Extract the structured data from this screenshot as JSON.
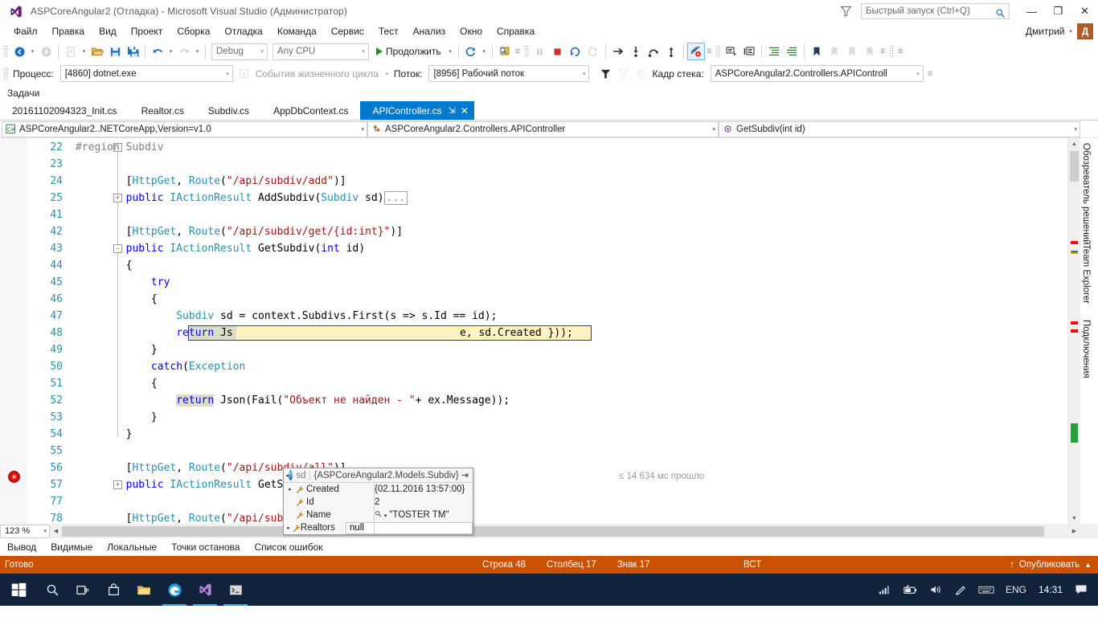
{
  "window": {
    "title": "ASPCoreAngular2 (Отладка) - Microsoft Visual Studio (Администратор)",
    "quick_launch_placeholder": "Быстрый запуск (Ctrl+Q)",
    "minimize": "—",
    "maximize": "❐",
    "close": "✕"
  },
  "menu": {
    "items": [
      "Файл",
      "Правка",
      "Вид",
      "Проект",
      "Сборка",
      "Отладка",
      "Команда",
      "Сервис",
      "Тест",
      "Анализ",
      "Окно",
      "Справка"
    ],
    "user_name": "Дмитрий",
    "user_initial": "Д"
  },
  "toolbar": {
    "config": "Debug",
    "platform": "Any CPU",
    "continue_label": "Продолжить",
    "back_icon": "nav-back-icon",
    "forward_icon": "nav-forward-icon",
    "new_icon": "new-project-icon",
    "open_icon": "open-file-icon",
    "save_icon": "save-icon",
    "save_all_icon": "save-all-icon",
    "undo_icon": "undo-icon",
    "redo_icon": "redo-icon",
    "refresh_icon": "refresh-icon",
    "find_icon": "find-icon",
    "pause_icon": "pause-icon",
    "stop_icon": "stop-icon",
    "restart_icon": "restart-icon",
    "hotreload_icon": "hot-reload-icon",
    "showstmt_icon": "show-next-statement-icon",
    "stepinto_icon": "step-into-icon",
    "stepover_icon": "step-over-icon",
    "stepout_icon": "step-out-icon",
    "breakpoints_icon": "breakpoints-toggle-icon",
    "comment_icon": "comment-icon",
    "uncomment_icon": "uncomment-icon",
    "indent_icon": "indent-icon",
    "outdent_icon": "outdent-icon",
    "bookmark_icon": "bookmark-icon",
    "bm_prev_icon": "bookmark-prev-icon",
    "bm_next_icon": "bookmark-next-icon",
    "bm_clear_icon": "bookmark-clear-icon"
  },
  "debug_toolbar": {
    "process_label": "Процесс:",
    "process_value": "[4860] dotnet.exe",
    "lifecycle_label": "События жизненного цикла",
    "thread_label": "Поток:",
    "thread_value": "[8956] Рабочий поток",
    "stackframe_label": "Кадр стека:",
    "stackframe_value": "ASPCoreAngular2.Controllers.APIControll",
    "filter_icon": "filter-icon",
    "filter2_icon": "filter-threads-icon",
    "noflag_icon": "no-flag-icon"
  },
  "tasks_strip": {
    "label": "Задачи"
  },
  "tabs": {
    "items": [
      {
        "label": "20161102094323_Init.cs",
        "active": false
      },
      {
        "label": "Realtor.cs",
        "active": false
      },
      {
        "label": "Subdiv.cs",
        "active": false
      },
      {
        "label": "AppDbContext.cs",
        "active": false
      },
      {
        "label": "APIController.cs",
        "active": true
      }
    ],
    "pin_glyph": "⇲",
    "close_glyph": "✕"
  },
  "navbar": {
    "project": "ASPCoreAngular2..NETCoreApp,Version=v1.0",
    "project_icon": "csharp-project-icon",
    "class": "ASPCoreAngular2.Controllers.APIController",
    "class_icon": "class-icon",
    "member": "GetSubdiv(int id)",
    "member_icon": "method-icon",
    "arrow": "▾"
  },
  "code": {
    "lines": [
      {
        "num": "22",
        "indent": 0,
        "glyph": "-",
        "segments": [
          {
            "t": "#region Subdiv",
            "c": "pre"
          }
        ]
      },
      {
        "num": "23",
        "indent": 0,
        "glyph": "",
        "segments": []
      },
      {
        "num": "24",
        "indent": 0,
        "glyph": "",
        "segments": [
          {
            "t": "        [",
            "c": "plain"
          },
          {
            "t": "HttpGet",
            "c": "type"
          },
          {
            "t": ", ",
            "c": "plain"
          },
          {
            "t": "Route",
            "c": "type"
          },
          {
            "t": "(",
            "c": "plain"
          },
          {
            "t": "\"/api/subdiv/add\"",
            "c": "str"
          },
          {
            "t": ")]",
            "c": "plain"
          }
        ]
      },
      {
        "num": "25",
        "indent": 0,
        "glyph": "+",
        "segments": [
          {
            "t": "        ",
            "c": "plain"
          },
          {
            "t": "public",
            "c": "kw"
          },
          {
            "t": " ",
            "c": "plain"
          },
          {
            "t": "IActionResult",
            "c": "type"
          },
          {
            "t": " AddSubdiv(",
            "c": "plain"
          },
          {
            "t": "Subdiv",
            "c": "type"
          },
          {
            "t": " sd)",
            "c": "plain"
          },
          {
            "t": "...",
            "c": "collapsed"
          }
        ]
      },
      {
        "num": "41",
        "indent": 0,
        "glyph": "",
        "segments": []
      },
      {
        "num": "42",
        "indent": 0,
        "glyph": "",
        "segments": [
          {
            "t": "        [",
            "c": "plain"
          },
          {
            "t": "HttpGet",
            "c": "type"
          },
          {
            "t": ", ",
            "c": "plain"
          },
          {
            "t": "Route",
            "c": "type"
          },
          {
            "t": "(",
            "c": "plain"
          },
          {
            "t": "\"/api/subdiv/get/{id:int}\"",
            "c": "str"
          },
          {
            "t": ")]",
            "c": "plain"
          }
        ]
      },
      {
        "num": "43",
        "indent": 0,
        "glyph": "-",
        "segments": [
          {
            "t": "        ",
            "c": "plain"
          },
          {
            "t": "public",
            "c": "kw"
          },
          {
            "t": " ",
            "c": "plain"
          },
          {
            "t": "IActionResult",
            "c": "type"
          },
          {
            "t": " GetSubdiv(",
            "c": "plain"
          },
          {
            "t": "int",
            "c": "kw"
          },
          {
            "t": " id)",
            "c": "plain"
          }
        ]
      },
      {
        "num": "44",
        "indent": 0,
        "glyph": "",
        "segments": [
          {
            "t": "        {",
            "c": "plain"
          }
        ]
      },
      {
        "num": "45",
        "indent": 0,
        "glyph": "",
        "segments": [
          {
            "t": "            ",
            "c": "plain"
          },
          {
            "t": "try",
            "c": "kw"
          }
        ]
      },
      {
        "num": "46",
        "indent": 0,
        "glyph": "",
        "segments": [
          {
            "t": "            {",
            "c": "plain"
          }
        ]
      },
      {
        "num": "47",
        "indent": 0,
        "glyph": "",
        "segments": [
          {
            "t": "                ",
            "c": "plain"
          },
          {
            "t": "Subdiv",
            "c": "type"
          },
          {
            "t": " sd = context.Subdivs.First(s => s.Id == id);",
            "c": "plain"
          }
        ]
      },
      {
        "num": "48",
        "indent": 0,
        "glyph": "",
        "current": true,
        "segments": [
          {
            "t": "                ",
            "c": "plain"
          },
          {
            "t": "return",
            "c": "kw"
          },
          {
            "t": " Js",
            "c": "plain"
          }
        ]
      },
      {
        "num": "49",
        "indent": 0,
        "glyph": "",
        "segments": [
          {
            "t": "            }",
            "c": "plain"
          }
        ]
      },
      {
        "num": "50",
        "indent": 0,
        "glyph": "",
        "segments": [
          {
            "t": "            ",
            "c": "plain"
          },
          {
            "t": "catch",
            "c": "kw"
          },
          {
            "t": "(",
            "c": "plain"
          },
          {
            "t": "Exception",
            "c": "type"
          }
        ]
      },
      {
        "num": "51",
        "indent": 0,
        "glyph": "",
        "segments": [
          {
            "t": "            {",
            "c": "plain"
          }
        ]
      },
      {
        "num": "52",
        "indent": 0,
        "glyph": "",
        "segments": [
          {
            "t": "                ",
            "c": "plain"
          },
          {
            "t": "return",
            "c": "kw",
            "hl": true
          },
          {
            "t": " Json(Fail(",
            "c": "plain"
          },
          {
            "t": "\"Объект не найден - \"",
            "c": "str"
          },
          {
            "t": "+ ex.Message));",
            "c": "plain"
          }
        ]
      },
      {
        "num": "53",
        "indent": 0,
        "glyph": "",
        "segments": [
          {
            "t": "            }",
            "c": "plain"
          }
        ]
      },
      {
        "num": "54",
        "indent": 0,
        "glyph": "",
        "segments": [
          {
            "t": "        }",
            "c": "plain"
          }
        ]
      },
      {
        "num": "55",
        "indent": 0,
        "glyph": "",
        "segments": []
      },
      {
        "num": "56",
        "indent": 0,
        "glyph": "",
        "segments": [
          {
            "t": "        [",
            "c": "plain"
          },
          {
            "t": "HttpGet",
            "c": "type"
          },
          {
            "t": ", ",
            "c": "plain"
          },
          {
            "t": "Route",
            "c": "type"
          },
          {
            "t": "(",
            "c": "plain"
          },
          {
            "t": "\"/api/subdiv/all\"",
            "c": "str"
          },
          {
            "t": ")]",
            "c": "plain"
          }
        ]
      },
      {
        "num": "57",
        "indent": 0,
        "glyph": "+",
        "segments": [
          {
            "t": "        ",
            "c": "plain"
          },
          {
            "t": "public",
            "c": "kw"
          },
          {
            "t": " ",
            "c": "plain"
          },
          {
            "t": "IActionResult",
            "c": "type"
          },
          {
            "t": " GetSubdivs()",
            "c": "plain"
          },
          {
            "t": "...",
            "c": "collapsed"
          }
        ]
      },
      {
        "num": "77",
        "indent": 0,
        "glyph": "",
        "segments": []
      },
      {
        "num": "78",
        "indent": 0,
        "glyph": "",
        "segments": [
          {
            "t": "        [",
            "c": "plain"
          },
          {
            "t": "HttpGet",
            "c": "type"
          },
          {
            "t": ", ",
            "c": "plain"
          },
          {
            "t": "Route",
            "c": "type"
          },
          {
            "t": "(",
            "c": "plain"
          },
          {
            "t": "\"/api/subdiv/delete/{id:int}\"",
            "c": "str"
          },
          {
            "t": ")]",
            "c": "plain"
          }
        ]
      }
    ],
    "current_line_tail": "e, sd.Created }));",
    "breakpoint_line": "48"
  },
  "datatip": {
    "expression": "sd",
    "type_value": "{ASPCoreAngular2.Models.Subdiv}",
    "caret": "◂",
    "pin_glyph": "⇥",
    "rows": [
      {
        "expandable": true,
        "name": "Created",
        "value": "{02.11.2016 13:57:00}",
        "edit": false,
        "magnifier": false
      },
      {
        "expandable": false,
        "name": "Id",
        "value": "2",
        "edit": false,
        "magnifier": false
      },
      {
        "expandable": false,
        "name": "Name",
        "value": "\"TOSTER TM\"",
        "edit": false,
        "magnifier": true
      },
      {
        "expandable": true,
        "name": "Realtors",
        "value": "null",
        "edit": true,
        "magnifier": false
      }
    ]
  },
  "perf_tip": {
    "text": "≤ 14 634 мс прошло"
  },
  "right_docks": {
    "items": [
      "Обозреватель решений",
      "Team Explorer",
      "Подключения"
    ]
  },
  "editor_footer": {
    "zoom": "123 %",
    "zoom_arrow": "▾"
  },
  "bottom_tabs": {
    "items": [
      "Вывод",
      "Видимые",
      "Локальные",
      "Точки останова",
      "Список ошибок"
    ]
  },
  "statusbar": {
    "state": "Готово",
    "line_label": "Строка 48",
    "col_label": "Столбец 17",
    "char_label": "Знак 17",
    "insert_mode": "ВСТ",
    "publish": "Опубликовать",
    "publish_arrow": "▲",
    "publish_up": "↑",
    "color": "#ca5100"
  },
  "taskbar": {
    "start_icon": "windows-start-icon",
    "items": [
      {
        "icon": "search-icon",
        "active": false
      },
      {
        "icon": "task-view-icon",
        "active": false
      },
      {
        "icon": "store-icon",
        "active": false
      },
      {
        "icon": "file-explorer-icon",
        "active": false
      },
      {
        "icon": "edge-browser-icon",
        "active": true
      },
      {
        "icon": "visual-studio-icon",
        "active": true
      },
      {
        "icon": "terminal-icon",
        "active": true
      }
    ],
    "tray": [
      {
        "icon": "network-signal-icon"
      },
      {
        "icon": "battery-icon"
      },
      {
        "icon": "volume-icon"
      },
      {
        "icon": "pen-icon"
      },
      {
        "icon": "keyboard-icon"
      }
    ],
    "language": "ENG",
    "clock": "14:31",
    "notification_icon": "action-center-icon"
  }
}
